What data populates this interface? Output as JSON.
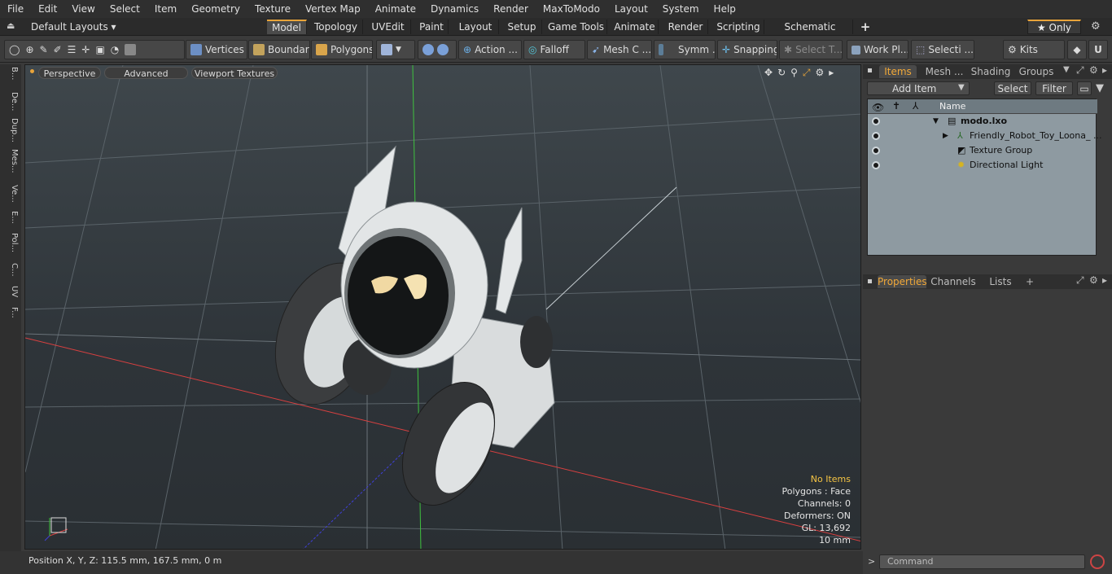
{
  "menu": [
    "File",
    "Edit",
    "View",
    "Select",
    "Item",
    "Geometry",
    "Texture",
    "Vertex Map",
    "Animate",
    "Dynamics",
    "Render",
    "MaxToModo",
    "Layout",
    "System",
    "Help"
  ],
  "layout_dropdown": "Default Layouts ▾",
  "tabs": [
    "Model",
    "Topology",
    "UVEdit",
    "Paint",
    "Layout",
    "Setup",
    "Game Tools",
    "Animate",
    "Render",
    "Scripting",
    "Schematic Fusion"
  ],
  "tab_add": "+",
  "only_label": "★ Only",
  "toolbar": {
    "vertices": "Vertices",
    "boundary": "Boundary",
    "polygons": "Polygons",
    "action": "Action ...",
    "falloff": "Falloff",
    "mesh": "Mesh C ...",
    "symm": "Symm ...",
    "snapping": "Snapping",
    "select_t": "Select T...",
    "work_pl": "Work Pl...",
    "selecti": "Selecti ...",
    "kits": "Kits"
  },
  "left_tabs": [
    "B...",
    "De...",
    "Dup...",
    "Mes...",
    "Ve...",
    "E...",
    "Pol...",
    "C...",
    "UV",
    "F..."
  ],
  "viewport": {
    "perspective": "Perspective",
    "advanced": "Advanced",
    "textures": "Viewport Textures",
    "hud": {
      "items": "No Items",
      "polygons": "Polygons : Face",
      "channels": "Channels: 0",
      "deformers": "Deformers: ON",
      "gl": "GL: 13,692",
      "scale": "10 mm"
    }
  },
  "status": {
    "position": "Position X, Y, Z:   115.5 mm, 167.5 mm, 0 m"
  },
  "items_panel": {
    "tabs": [
      "Items",
      "Mesh ...",
      "Shading",
      "Groups"
    ],
    "add_item": "Add Item",
    "select": "Select",
    "filter": "Filter",
    "name_header": "Name",
    "tree": [
      {
        "label": "modo.lxo"
      },
      {
        "label": "Friendly_Robot_Toy_Loona_ ..."
      },
      {
        "label": "Texture Group"
      },
      {
        "label": "Directional Light"
      }
    ]
  },
  "properties_panel": {
    "tabs": [
      "Properties",
      "Channels",
      "Lists"
    ],
    "plus": "+"
  },
  "command": {
    "placeholder": "Command",
    "prompt": ">"
  },
  "colors": {
    "accent": "#e8a43a",
    "hud_yellow": "#f5c443",
    "axis_red": "#d94040",
    "axis_green": "#3fc23f",
    "axis_blue": "#4040d9"
  }
}
